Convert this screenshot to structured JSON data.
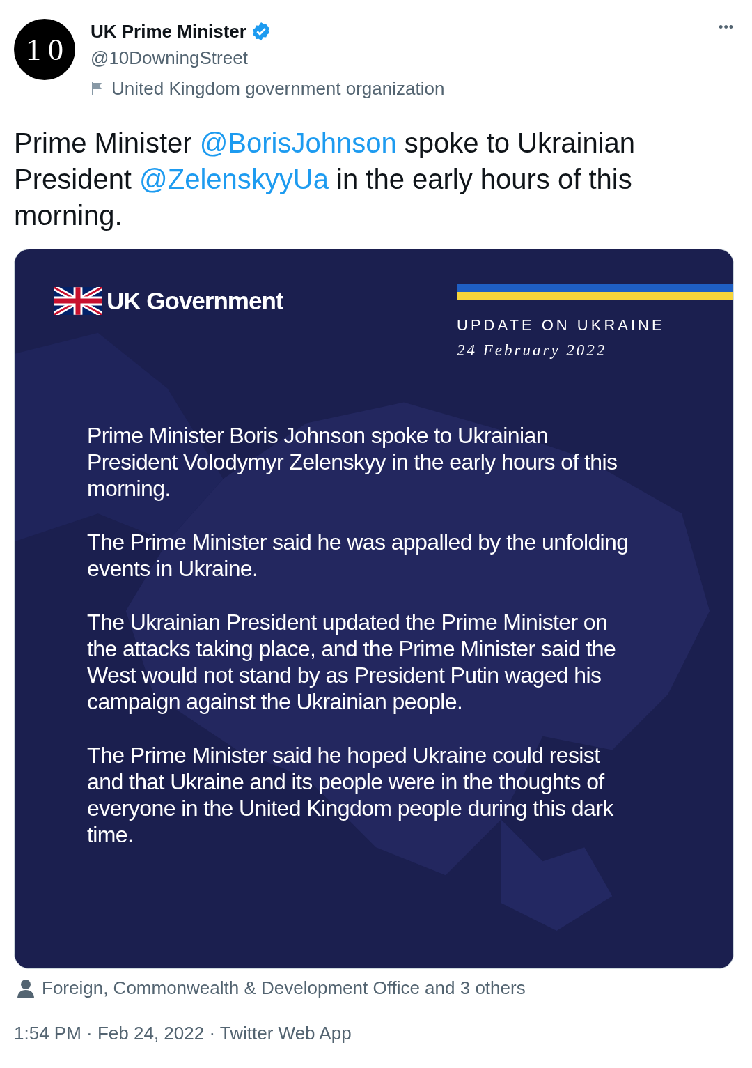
{
  "author": {
    "avatar_text": "10",
    "name": "UK Prime Minister",
    "verified": true,
    "handle": "@10DowningStreet",
    "label": "United Kingdom government organization"
  },
  "more_button": "•••",
  "tweet_text": [
    {
      "kind": "text",
      "text": "Prime Minister "
    },
    {
      "kind": "mention",
      "text": "@BorisJohnson"
    },
    {
      "kind": "text",
      "text": " spoke to Ukrainian President "
    },
    {
      "kind": "mention",
      "text": "@ZelenskyyUa"
    },
    {
      "kind": "text",
      "text": " in the early hours of this morning."
    }
  ],
  "image": {
    "brand": "UK Government",
    "heading": "UPDATE ON UKRAINE",
    "date": "24 February 2022",
    "paragraphs": [
      "Prime Minister Boris Johnson spoke to Ukrainian President Volodymyr Zelenskyy in the early hours of this morning.",
      "The Prime Minister said he was appalled by the unfolding events in Ukraine.",
      "The Ukrainian President updated the Prime Minister on the attacks taking place, and the Prime Minister said the West would not stand by as President Putin waged his campaign against the Ukrainian people.",
      "The Prime Minister said he hoped Ukraine could resist and that Ukraine and its people were in the thoughts of everyone in the United Kingdom people during this dark time."
    ]
  },
  "tagged": "Foreign, Commonwealth & Development Office and 3 others",
  "meta": "1:54 PM · Feb 24, 2022 · Twitter Web App"
}
